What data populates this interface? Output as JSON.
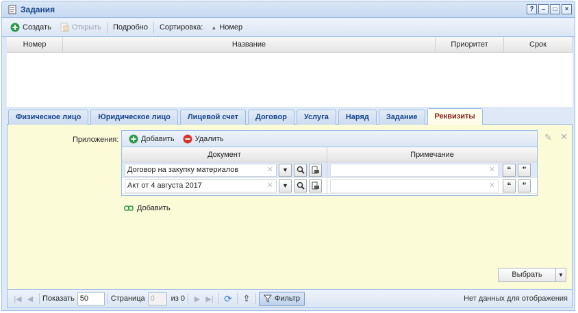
{
  "window": {
    "title": "Задания",
    "tools": {
      "help": "?",
      "minimize": "–",
      "maximize": "□",
      "close": "×"
    }
  },
  "toolbar": {
    "create": "Создать",
    "open": "Открыть",
    "details": "Подробно",
    "sort_label": "Сортировка:",
    "sort_value": "Номер"
  },
  "grid": {
    "columns": [
      "Номер",
      "Название",
      "Приоритет",
      "Срок"
    ]
  },
  "tabs": [
    {
      "label": "Физическое лицо",
      "active": false
    },
    {
      "label": "Юридическое лицо",
      "active": false
    },
    {
      "label": "Лицевой счет",
      "active": false
    },
    {
      "label": "Договор",
      "active": false
    },
    {
      "label": "Услуга",
      "active": false
    },
    {
      "label": "Наряд",
      "active": false
    },
    {
      "label": "Задание",
      "active": false
    },
    {
      "label": "Реквизиты",
      "active": true
    }
  ],
  "attachments": {
    "label": "Приложения:",
    "add": "Добавить",
    "remove": "Удалить",
    "columns": {
      "document": "Документ",
      "note": "Примечание"
    },
    "rows": [
      {
        "document": "Договор на закупку материалов",
        "note": ""
      },
      {
        "document": "Акт от 4 августа 2017",
        "note": ""
      }
    ],
    "add_link": "Добавить"
  },
  "choose_button": "Выбрать",
  "pager": {
    "show_label": "Показать",
    "page_size": "50",
    "page_label": "Страница",
    "page_value": "0",
    "of_label": "из 0",
    "filter": "Фильтр",
    "status": "Нет данных для отображения"
  },
  "colors": {
    "border": "#99bbe8",
    "title_text": "#15428b",
    "panel_bg": "#fcfbd8",
    "add_green": "#2e9b4a",
    "delete_red": "#d9342b",
    "active_tab_text": "#8a1a1a"
  }
}
